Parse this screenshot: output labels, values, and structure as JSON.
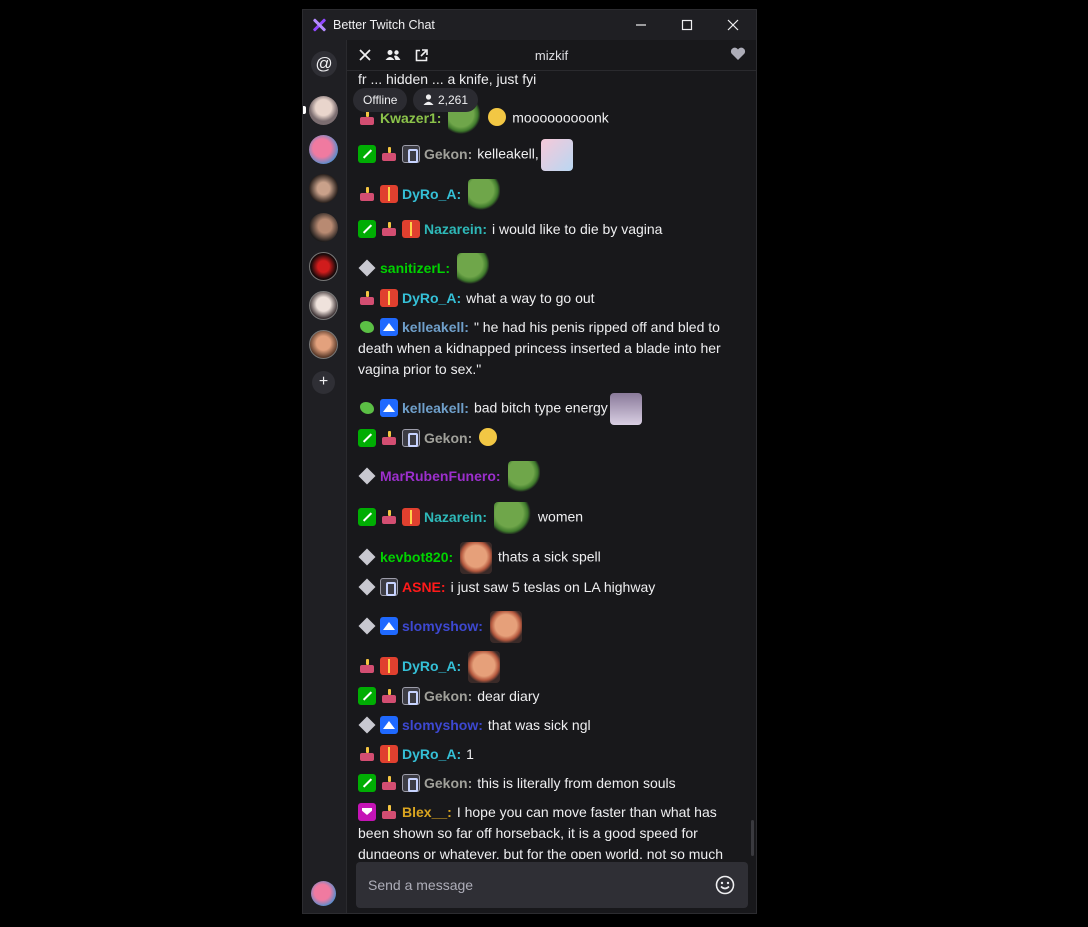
{
  "window": {
    "title": "Better Twitch Chat"
  },
  "header": {
    "channel": "mizkif"
  },
  "stream": {
    "status": "Offline",
    "viewers": "2,261"
  },
  "colors": {
    "green": "#00d200",
    "cyan": "#2eb8b8",
    "gray": "#a0a09a",
    "teal": "#35c0d7",
    "steel": "#6f9fca",
    "purple": "#9c2fcd",
    "red": "#ff1a1a",
    "blue": "#3d48d1",
    "gold": "#daa520"
  },
  "messages": [
    {
      "text": "fr ... hidden ... a knife, just fyi"
    },
    {
      "user": "Kwazer1:",
      "text": "mooooooooonk"
    },
    {
      "user": "Gekon:",
      "text": "kelleakell,"
    },
    {
      "user": "DyRo_A:",
      "text": ""
    },
    {
      "user": "Nazarein:",
      "text": "i would like to die by vagina"
    },
    {
      "user": "sanitizerL:",
      "text": ""
    },
    {
      "user": "DyRo_A:",
      "text": "what a way to go out"
    },
    {
      "user": "kelleakell:",
      "text": "\" he had his penis ripped off and bled to death when a kidnapped princess inserted a blade into her vagina prior to sex.\""
    },
    {
      "user": "kelleakell:",
      "text": "bad bitch type energy"
    },
    {
      "user": "Gekon:",
      "text": ""
    },
    {
      "user": "MarRubenFunero:",
      "text": ""
    },
    {
      "user": "Nazarein:",
      "text": "women"
    },
    {
      "user": "kevbot820:",
      "text": "thats a sick spell"
    },
    {
      "user": "ASNE:",
      "text": "i just saw 5 teslas on LA highway"
    },
    {
      "user": "slomyshow:",
      "text": ""
    },
    {
      "user": "DyRo_A:",
      "text": ""
    },
    {
      "user": "Gekon:",
      "text": "dear diary"
    },
    {
      "user": "slomyshow:",
      "text": "that was sick ngl"
    },
    {
      "user": "DyRo_A:",
      "text": "1"
    },
    {
      "user": "Gekon:",
      "text": "this is literally from demon souls"
    },
    {
      "user": "Blex__:",
      "text": "I hope you can move faster than what has been shown so far off horseback, it is a good speed for dungeons or whatever, but for the open world, not so much"
    }
  ],
  "composer": {
    "placeholder": "Send a message"
  }
}
